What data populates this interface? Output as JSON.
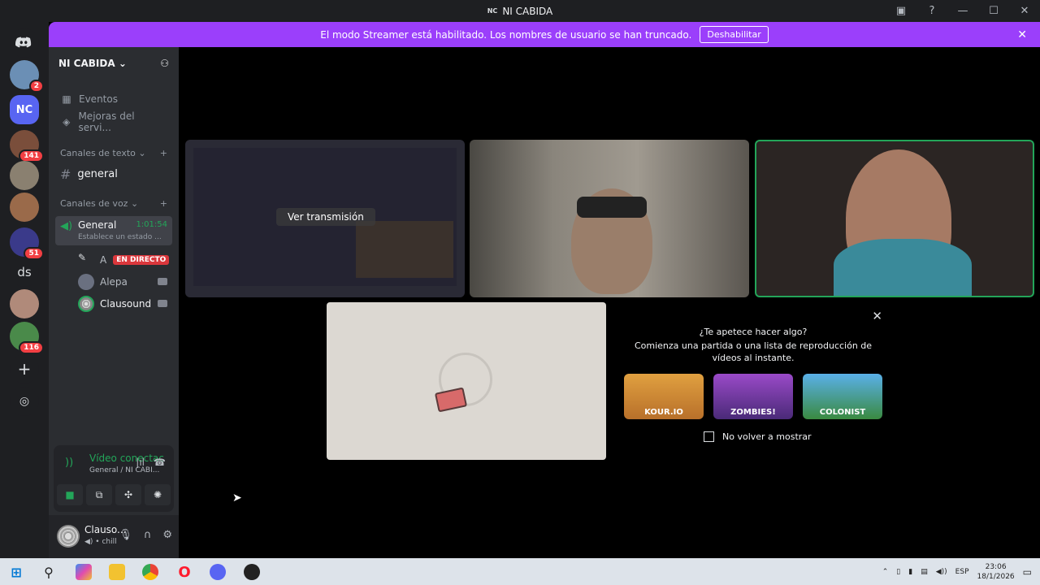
{
  "window": {
    "title_icon": "NC",
    "title": "NI CABIDA"
  },
  "banner": {
    "text": "El modo Streamer está habilitado. Los nombres de usuario se han truncado.",
    "button": "Deshabilitar"
  },
  "guilds": [
    {
      "label": "",
      "badge": "2",
      "color": "#6b8fb5"
    },
    {
      "label": "NC",
      "badge": "",
      "color": "#5865f2"
    },
    {
      "label": "",
      "badge": "141",
      "color": "#7a4e3b"
    },
    {
      "label": "",
      "badge": "",
      "color": "#8a8070"
    },
    {
      "label": "",
      "badge": "",
      "color": "#9a6a4a"
    },
    {
      "label": "",
      "badge": "51",
      "color": "#3a3a8a"
    },
    {
      "label": "ds",
      "badge": "",
      "color": "#1e1f22"
    },
    {
      "label": "",
      "badge": "",
      "color": "#b08a7a"
    },
    {
      "label": "",
      "badge": "116",
      "color": "#4a8a4a"
    }
  ],
  "sidebar": {
    "server_name": "NI CABIDA",
    "events": "Eventos",
    "boosts": "Mejoras del servi...",
    "text_category": "Canales de texto",
    "text_channel": "general",
    "voice_category": "Canales de voz",
    "voice_channel": {
      "name": "General",
      "time": "1:01:54",
      "status": "Establece un estado ..."
    },
    "members": [
      {
        "name": "A",
        "live": "EN DIRECTO"
      },
      {
        "name": "Alepa"
      },
      {
        "name": "Clausound"
      }
    ]
  },
  "voice_panel": {
    "status": "Vídeo conectac",
    "location": "General / NI CABI..."
  },
  "user": {
    "name": "Clauso...",
    "status": "chill"
  },
  "stage": {
    "stream_label": "Ver transmisión"
  },
  "activity": {
    "heading": "¿Te apetece hacer algo?",
    "description": "Comienza una partida o una lista de reproducción de vídeos al instante.",
    "games": [
      {
        "name": "KOUR.IO",
        "color": "#d48a2a"
      },
      {
        "name": "ZOMBIES!",
        "color": "#7a3aa8"
      },
      {
        "name": "COLONIST",
        "color": "#3a8ad0"
      }
    ],
    "checkbox": "No volver a mostrar"
  },
  "taskbar": {
    "lang": "ESP",
    "time": "23:06",
    "date": "18/1/2026"
  }
}
